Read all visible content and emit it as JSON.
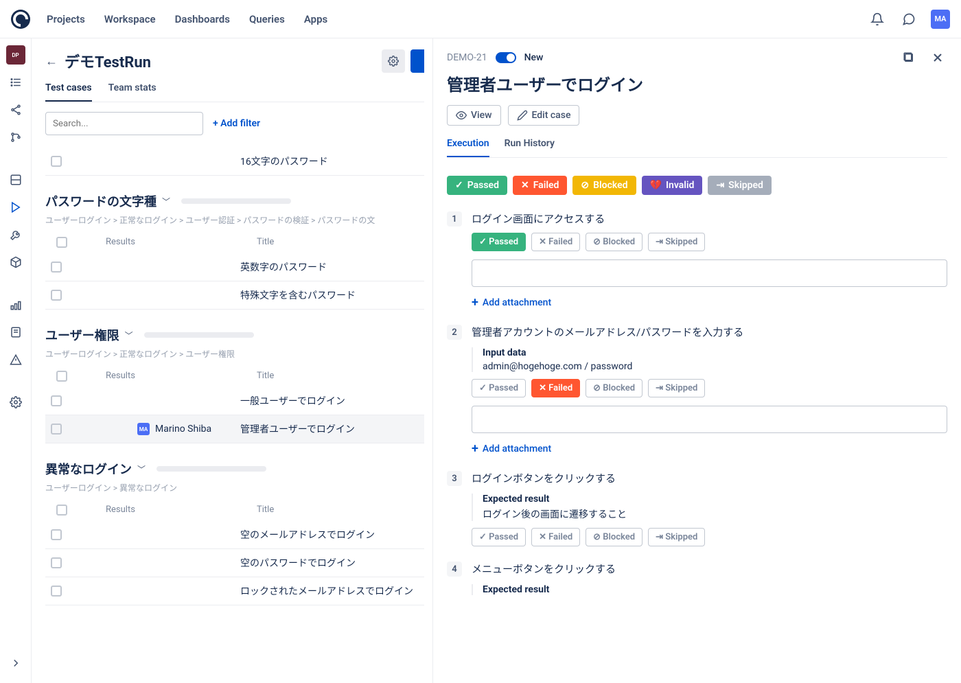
{
  "topnav": [
    "Projects",
    "Workspace",
    "Dashboards",
    "Queries",
    "Apps"
  ],
  "avatar": "MA",
  "left": {
    "title": "デモTestRun",
    "tabs": [
      "Test cases",
      "Team stats"
    ],
    "search_placeholder": "Search...",
    "add_filter": "+ Add filter",
    "first_row": "16文字のパスワード",
    "groups": [
      {
        "title": "パスワードの文字種",
        "breadcrumb": "ユーザーログイン > 正常なログイン > ユーザー認証 > パスワードの検証 > パスワードの文",
        "col_results": "Results",
        "col_title": "Title",
        "rows": [
          {
            "title": "英数字のパスワード"
          },
          {
            "title": "特殊文字を含むパスワード"
          }
        ]
      },
      {
        "title": "ユーザー権限",
        "breadcrumb": "ユーザーログイン > 正常なログイン > ユーザー権限",
        "col_results": "Results",
        "col_title": "Title",
        "rows": [
          {
            "title": "一般ユーザーでログイン"
          },
          {
            "title": "管理者ユーザーでログイン",
            "assignee": "MA",
            "assignee_name": "Marino Shiba",
            "selected": true
          }
        ]
      },
      {
        "title": "異常なログイン",
        "breadcrumb": "ユーザーログイン > 異常なログイン",
        "col_results": "Results",
        "col_title": "Title",
        "rows": [
          {
            "title": "空のメールアドレスでログイン"
          },
          {
            "title": "空のパスワードでログイン"
          },
          {
            "title": "ロックされたメールアドレスでログイン"
          }
        ]
      }
    ]
  },
  "right": {
    "id": "DEMO-21",
    "status": "New",
    "title": "管理者ユーザーでログイン",
    "view": "View",
    "edit": "Edit case",
    "tabs": [
      "Execution",
      "Run History"
    ],
    "statuses": {
      "passed": "Passed",
      "failed": "Failed",
      "blocked": "Blocked",
      "invalid": "Invalid",
      "skipped": "Skipped"
    },
    "add_attachment": "Add attachment",
    "input_data_label": "Input data",
    "expected_label": "Expected result",
    "steps": [
      {
        "num": "1",
        "title": "ログイン画面にアクセスする",
        "state": "passed",
        "attach": true
      },
      {
        "num": "2",
        "title": "管理者アカウントのメールアドレス/パスワードを入力する",
        "input_data": "admin@hogehoge.com / password",
        "state": "failed",
        "attach": true
      },
      {
        "num": "3",
        "title": "ログインボタンをクリックする",
        "expected": "ログイン後の画面に遷移すること",
        "state": "none"
      },
      {
        "num": "4",
        "title": "メニューボタンをクリックする",
        "expected_label_only": true
      }
    ]
  }
}
